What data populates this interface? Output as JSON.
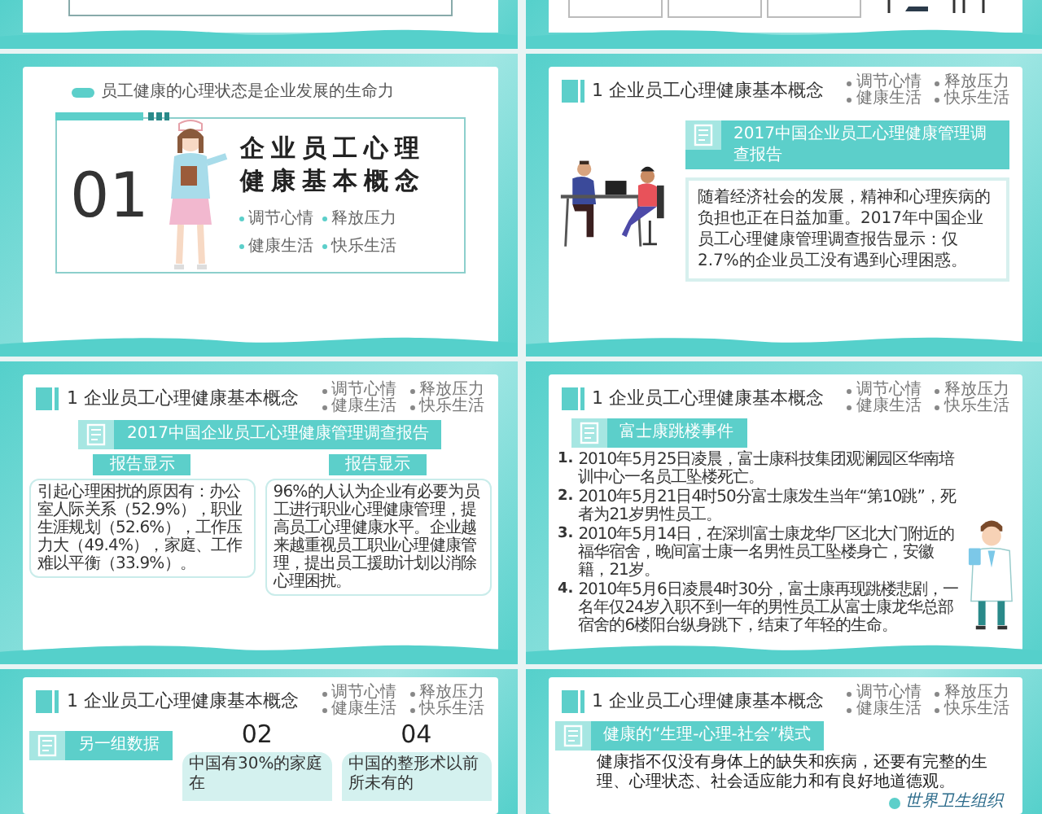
{
  "rows": [
    {
      "kind": "tail",
      "slides": [
        {
          "kind": "frame"
        },
        {
          "kind": "boxes"
        }
      ]
    },
    {
      "kind": "full",
      "slides": [
        {
          "kind": "cover",
          "subtitle": "员工健康的心理状态是企业发展的生命力",
          "number": "01",
          "title_lines": [
            "企业员工心理",
            "健康基本概念"
          ],
          "bullets": [
            "调节心情",
            "释放压力",
            "健康生活",
            "快乐生活"
          ]
        },
        {
          "kind": "report",
          "header": {
            "title": "1 企业员工心理健康基本概念",
            "nav": [
              "调节心情",
              "释放压力",
              "健康生活",
              "快乐生活"
            ]
          },
          "banner": "2017中国企业员工心理健康管理调查报告",
          "text": "随着经济社会的发展，精神和心理疾病的负担也正在日益加重。2017年中国企业员工心理健康管理调查报告显示：仅2.7%的企业员工没有遇到心理困惑。"
        }
      ]
    },
    {
      "kind": "full",
      "slides": [
        {
          "kind": "two-reports",
          "header": {
            "title": "1 企业员工心理健康基本概念",
            "nav": [
              "调节心情",
              "释放压力",
              "健康生活",
              "快乐生活"
            ]
          },
          "banner": "2017中国企业员工心理健康管理调查报告",
          "columns": [
            {
              "label": "报告显示",
              "text": "引起心理困扰的原因有：办公室人际关系（52.9%），职业生涯规划（52.6%），工作压力大（49.4%），家庭、工作难以平衡（33.9%）。"
            },
            {
              "label": "报告显示",
              "text": "96%的人认为企业有必要为员工进行职业心理健康管理，提高员工心理健康水平。企业越来越重视员工职业心理健康管理，提出员工援助计划以消除心理困扰。"
            }
          ]
        },
        {
          "kind": "events",
          "header": {
            "title": "1 企业员工心理健康基本概念",
            "nav": [
              "调节心情",
              "释放压力",
              "健康生活",
              "快乐生活"
            ]
          },
          "banner": "富士康跳楼事件",
          "items": [
            {
              "marker": "1.",
              "text": "2010年5月25日凌晨，富士康科技集团观澜园区华南培训中心一名员工坠楼死亡。"
            },
            {
              "marker": "2.",
              "text": "2010年5月21日4时50分富士康发生当年“第10跳”，死者为21岁男性员工。"
            },
            {
              "marker": "3.",
              "text": "2010年5月14日，在深圳富士康龙华厂区北大门附近的福华宿舍，晚间富士康一名男性员工坠楼身亡，安徽籍，21岁。"
            },
            {
              "marker": "4.",
              "text": "2010年5月6日凌晨4时30分，富士康再现跳楼悲剧，一名年仅24岁入职不到一年的男性员工从富士康龙华总部宿舍的6楼阳台纵身跳下，结束了年轻的生命。"
            }
          ]
        }
      ]
    },
    {
      "kind": "head",
      "slides": [
        {
          "kind": "numbers",
          "header": {
            "title": "1 企业员工心理健康基本概念",
            "nav": [
              "调节心情",
              "释放压力",
              "健康生活",
              "快乐生活"
            ]
          },
          "banner": "另一组数据",
          "blocks": [
            {
              "number": "02",
              "text": "中国有30%的家庭在"
            },
            {
              "number": "04",
              "text": "中国的整形术以前所未有的"
            }
          ]
        },
        {
          "kind": "model",
          "header": {
            "title": "1 企业员工心理健康基本概念",
            "nav": [
              "调节心情",
              "释放压力",
              "健康生活",
              "快乐生活"
            ]
          },
          "banner": "健康的“生理-心理-社会”模式",
          "text": "健康指不仅没有身体上的缺失和疾病，还要有完整的生理、心理状态、社会适应能力和有良好地道德观。",
          "source": "世界卫生组织"
        }
      ]
    }
  ]
}
